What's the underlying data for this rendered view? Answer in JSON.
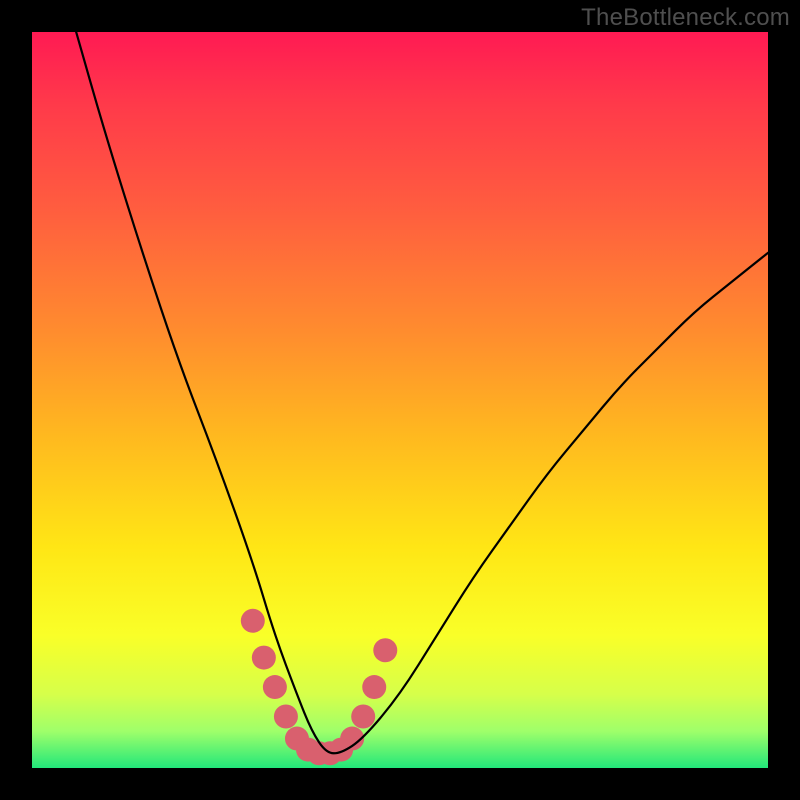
{
  "watermark": "TheBottleneck.com",
  "chart_data": {
    "type": "line",
    "title": "",
    "xlabel": "",
    "ylabel": "",
    "xlim": [
      0,
      100
    ],
    "ylim": [
      0,
      100
    ],
    "grid": false,
    "legend": false,
    "series": [
      {
        "name": "bottleneck-curve",
        "x": [
          6,
          10,
          15,
          20,
          25,
          30,
          33,
          36,
          38,
          40,
          42,
          45,
          50,
          55,
          60,
          65,
          70,
          75,
          80,
          85,
          90,
          95,
          100
        ],
        "values": [
          100,
          86,
          70,
          55,
          42,
          28,
          18,
          10,
          5,
          2,
          2,
          4,
          10,
          18,
          26,
          33,
          40,
          46,
          52,
          57,
          62,
          66,
          70
        ]
      }
    ],
    "overlay": {
      "name": "highlight-dots",
      "x": [
        30,
        31.5,
        33,
        34.5,
        36,
        37.5,
        39,
        40.5,
        42,
        43.5,
        45,
        46.5,
        48
      ],
      "values": [
        20,
        15,
        11,
        7,
        4,
        2.5,
        2,
        2,
        2.5,
        4,
        7,
        11,
        16
      ],
      "color": "#d9606e",
      "radius": 12
    },
    "background_gradient": {
      "stops": [
        {
          "pos": 0.0,
          "color": "#ff1a53"
        },
        {
          "pos": 0.1,
          "color": "#ff3a4a"
        },
        {
          "pos": 0.24,
          "color": "#ff5d3f"
        },
        {
          "pos": 0.4,
          "color": "#ff8a2f"
        },
        {
          "pos": 0.55,
          "color": "#ffb91f"
        },
        {
          "pos": 0.7,
          "color": "#ffe615"
        },
        {
          "pos": 0.82,
          "color": "#f9ff28"
        },
        {
          "pos": 0.9,
          "color": "#d6ff4a"
        },
        {
          "pos": 0.95,
          "color": "#9fff6a"
        },
        {
          "pos": 1.0,
          "color": "#22e77a"
        }
      ]
    }
  }
}
